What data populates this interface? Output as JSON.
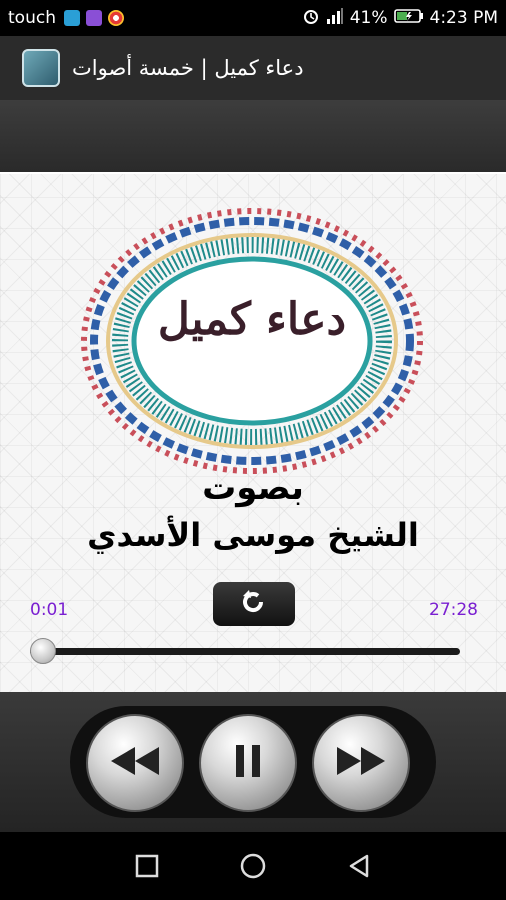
{
  "status_bar": {
    "carrier": "touch",
    "battery": "41%",
    "time": "4:23 PM",
    "icons": [
      "image-icon",
      "music-icon",
      "chrome-icon",
      "alarm-icon",
      "signal-icon",
      "battery-icon"
    ]
  },
  "app": {
    "title": "دعاء كميل | خمسة أصوات"
  },
  "main": {
    "emblem_text": "دعاء كميل",
    "reciter_label": "بصوت",
    "reciter_name": "الشيخ موسى الأسدي"
  },
  "player": {
    "current_time": "0:01",
    "total_time": "27:28",
    "progress": 0.0006
  },
  "controls": {
    "buttons": [
      "rewind-icon",
      "pause-icon",
      "fast-forward-icon"
    ]
  },
  "nav": {
    "buttons": [
      "recents-icon",
      "home-icon",
      "back-icon"
    ]
  },
  "colors": {
    "time_text": "#7a1fd1",
    "action_bar": "#2b2b2b"
  }
}
